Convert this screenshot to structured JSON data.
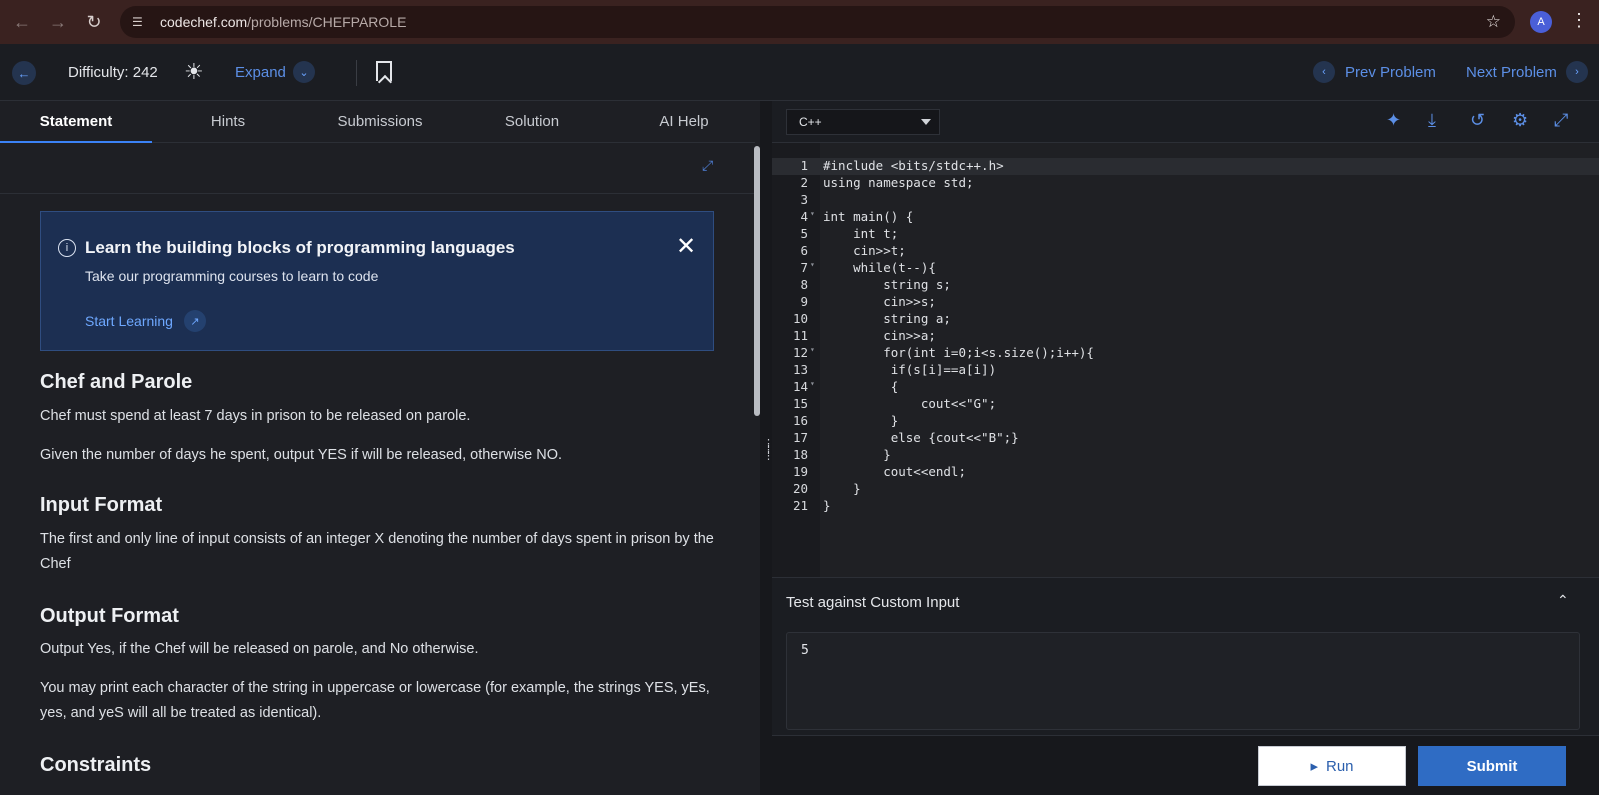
{
  "browser": {
    "url_host": "codechef.com",
    "url_path": "/problems/CHEFPAROLE"
  },
  "topbar": {
    "difficulty": "Difficulty: 242",
    "expand": "Expand",
    "prev": "Prev Problem",
    "next": "Next Problem"
  },
  "tabs": [
    "Statement",
    "Hints",
    "Submissions",
    "Solution",
    "AI Help"
  ],
  "banner": {
    "title": "Learn the building blocks of programming languages",
    "subtitle": "Take our programming courses to learn to code",
    "link": "Start Learning"
  },
  "problem": {
    "title": "Chef and Parole",
    "p1": "Chef must spend at least 7 days in prison to be released on parole.",
    "p2": "Given the number of days he spent, output YES if will be released, otherwise NO.",
    "input_heading": "Input Format",
    "input_text": "The first and only line of input consists of an integer X denoting the number of days spent in prison by the Chef",
    "output_heading": "Output Format",
    "output_text": "Output Yes, if the Chef will be released on parole, and No otherwise.",
    "case_text": "You may print each character of the string in uppercase or lowercase (for example, the strings YES, yEs, yes, and yeS will all be treated as identical).",
    "constraints_heading": "Constraints"
  },
  "editor": {
    "language": "C++",
    "lines": [
      {
        "n": "1",
        "code": "#include <bits/stdc++.h>",
        "fold": false
      },
      {
        "n": "2",
        "code": "using namespace std;",
        "fold": false
      },
      {
        "n": "3",
        "code": "",
        "fold": false
      },
      {
        "n": "4",
        "code": "int main() {",
        "fold": true
      },
      {
        "n": "5",
        "code": "    int t;",
        "fold": false
      },
      {
        "n": "6",
        "code": "    cin>>t;",
        "fold": false
      },
      {
        "n": "7",
        "code": "    while(t--){",
        "fold": true
      },
      {
        "n": "8",
        "code": "        string s;",
        "fold": false
      },
      {
        "n": "9",
        "code": "        cin>>s;",
        "fold": false
      },
      {
        "n": "10",
        "code": "        string a;",
        "fold": false
      },
      {
        "n": "11",
        "code": "        cin>>a;",
        "fold": false
      },
      {
        "n": "12",
        "code": "        for(int i=0;i<s.size();i++){",
        "fold": true
      },
      {
        "n": "13",
        "code": "         if(s[i]==a[i])",
        "fold": false
      },
      {
        "n": "14",
        "code": "         {",
        "fold": true
      },
      {
        "n": "15",
        "code": "             cout<<\"G\";",
        "fold": false
      },
      {
        "n": "16",
        "code": "         }",
        "fold": false
      },
      {
        "n": "17",
        "code": "         else {cout<<\"B\";}",
        "fold": false
      },
      {
        "n": "18",
        "code": "        }",
        "fold": false
      },
      {
        "n": "19",
        "code": "        cout<<endl;",
        "fold": false
      },
      {
        "n": "20",
        "code": "    }",
        "fold": false
      },
      {
        "n": "21",
        "code": "}",
        "fold": false
      }
    ]
  },
  "custom_input": {
    "label": "Test against Custom Input",
    "value": "5"
  },
  "actions": {
    "run": "Run",
    "submit": "Submit"
  }
}
